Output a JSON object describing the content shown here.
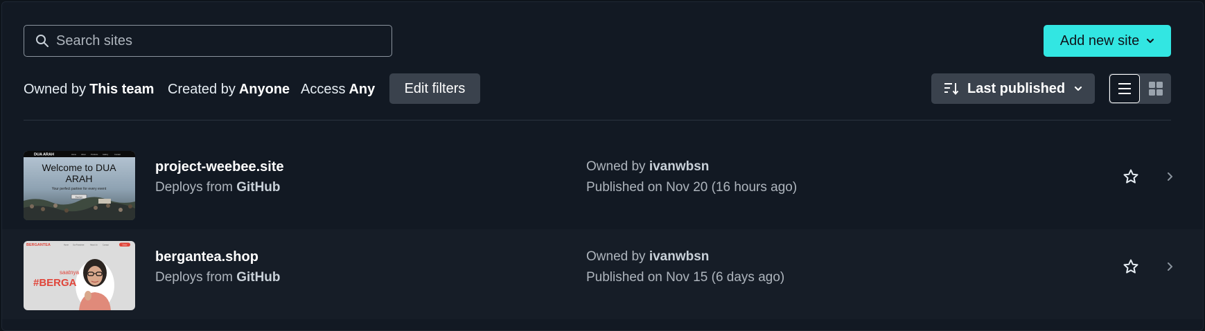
{
  "search": {
    "placeholder": "Search sites"
  },
  "add_button": {
    "label": "Add new site"
  },
  "filters": {
    "owned_prefix": "Owned by",
    "owned_value": "This team",
    "created_prefix": "Created by",
    "created_value": "Anyone",
    "access_prefix": "Access",
    "access_value": "Any",
    "edit_label": "Edit filters"
  },
  "sort": {
    "label": "Last published"
  },
  "view_toggle": {
    "selected": "list",
    "icons": [
      "list-view-icon",
      "grid-view-icon"
    ]
  },
  "sites": [
    {
      "name": "project-weebee.site",
      "deploy_prefix": "Deploys from",
      "deploy_source": "GitHub",
      "owner_prefix": "Owned by",
      "owner": "ivanwbsn",
      "published": "Published on Nov 20 (16 hours ago)",
      "thumb": {
        "brand": "DUA ARAH",
        "nav": [
          "Home",
          "About",
          "Products",
          "Gallery",
          "Contact"
        ],
        "headline1": "Welcome to DUA",
        "headline2": "ARAH",
        "tagline": "Your perfect partner for every event",
        "cta": "Explore"
      }
    },
    {
      "name": "bergantea.shop",
      "deploy_prefix": "Deploys from",
      "deploy_source": "GitHub",
      "owner_prefix": "Owned by",
      "owner": "ivanwbsn",
      "published": "Published on Nov 15 (6 days ago)",
      "thumb": {
        "brand": "BERGANTEA",
        "nav": [
          "Home",
          "Our Franchise",
          "About Us",
          "Contact"
        ],
        "cta": "Order",
        "small": "saatnya",
        "headline": "#BERGA"
      }
    }
  ],
  "colors": {
    "accent": "#32e6e2",
    "background": "#121923",
    "button": "#3a424d"
  }
}
